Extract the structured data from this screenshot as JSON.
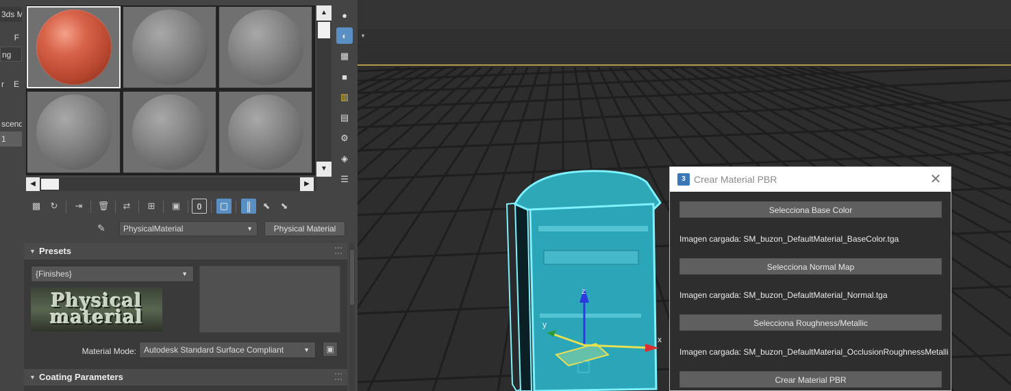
{
  "left_strip": {
    "items": [
      "3ds M",
      "F",
      "ng",
      "r",
      "E",
      "scend",
      "1"
    ]
  },
  "material_editor": {
    "slots": [
      {
        "material": "red"
      },
      {
        "material": "gray"
      },
      {
        "material": "gray"
      },
      {
        "material": "gray"
      },
      {
        "material": "gray"
      },
      {
        "material": "gray"
      }
    ],
    "scroll_up": "▲",
    "scroll_down": "▼",
    "scroll_left": "◀",
    "scroll_right": "▶",
    "side_icons": [
      "sample-type-icon",
      "backlight-icon",
      "background-icon",
      "uv-tiling-icon",
      "video-color-check-icon",
      "make-preview-icon",
      "options-icon",
      "select-by-material-icon",
      "material-map-navigator-icon"
    ],
    "toolbar_icons": [
      "get-material-icon",
      "put-to-scene-icon",
      "assign-to-selection-icon",
      "reset-map-icon",
      "make-unique-icon",
      "put-to-library-icon",
      "material-id-channel-icon",
      "show-shaded-icon",
      "show-end-result-icon",
      "go-to-parent-icon",
      "go-forward-icon"
    ],
    "material_id": "0",
    "material_name": "PhysicalMaterial",
    "material_type": "Physical Material",
    "presets": {
      "title": "Presets",
      "dropdown": "{Finishes}",
      "logo_line1": "Physical",
      "logo_line2": "material",
      "mode_label": "Material Mode:",
      "mode_value": "Autodesk Standard Surface Compliant"
    },
    "coating": {
      "title": "Coating Parameters"
    }
  },
  "viewport": {
    "background": "#2d2d2d",
    "grid_color": "#1e1e1e",
    "object_color": "#2aa6b8",
    "highlight": "#7ff2ff",
    "axis_x": "x",
    "axis_y": "y",
    "axis_z": "z"
  },
  "dialog": {
    "title": "Crear Material PBR",
    "app_icon": "3",
    "close": "✕",
    "buttons": {
      "base_color": "Selecciona Base Color",
      "normal_map": "Selecciona Normal Map",
      "roughness": "Selecciona Roughness/Metallic",
      "create": "Crear Material PBR"
    },
    "status": {
      "base_color": "Imagen cargada: SM_buzon_DefaultMaterial_BaseColor.tga",
      "normal": "Imagen cargada: SM_buzon_DefaultMaterial_Normal.tga",
      "roughness": "Imagen cargada: SM_buzon_DefaultMaterial_OcclusionRoughnessMetallic.tga"
    }
  }
}
